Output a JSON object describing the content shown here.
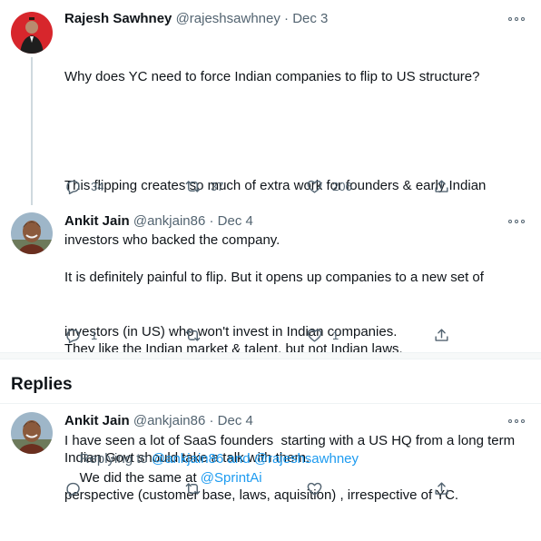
{
  "tweets": [
    {
      "name": "Rajesh Sawhney",
      "handle": "@rajeshsawhney",
      "date": "· Dec 3",
      "lines": [
        "Why does YC need to force Indian companies to flip to US structure?",
        "",
        "This flipping creates so much of extra work for founders & early Indian",
        "investors who backed the company.",
        "",
        "They like the Indian market & talent, but not Indian laws.",
        "",
        "Indian Govt should take a talk with them."
      ],
      "reply_count": "34",
      "retweet_count": "37",
      "like_count": "206"
    },
    {
      "name": "Ankit Jain",
      "handle": "@ankjain86",
      "date": "· Dec 4",
      "lines": [
        "It is definitely painful to flip. But it opens up companies to a new set of",
        "investors (in US) who won't invest in Indian companies.",
        "",
        "I have seen a lot of SaaS founders  starting with a US HQ from a long term",
        "perspective (customer base, laws, aquisition) , irrespective of YC."
      ],
      "reply_count": "1",
      "retweet_count": "",
      "like_count": "1"
    }
  ],
  "replies_heading": "Replies",
  "reply": {
    "name": "Ankit Jain",
    "handle": "@ankjain86",
    "date": "· Dec 4",
    "replying_prefix": "Replying to ",
    "replying_user1": "@ankjain86",
    "replying_and": " and ",
    "replying_user2": "@rajeshsawhney",
    "text_prefix": "We did the same at ",
    "text_mention": "@SprintAi"
  },
  "colors": {
    "accent": "#1d9bf0",
    "muted": "#536471",
    "divider": "#eff3f4"
  },
  "icons": [
    "reply-icon",
    "retweet-icon",
    "like-icon",
    "share-icon",
    "more-icon"
  ]
}
